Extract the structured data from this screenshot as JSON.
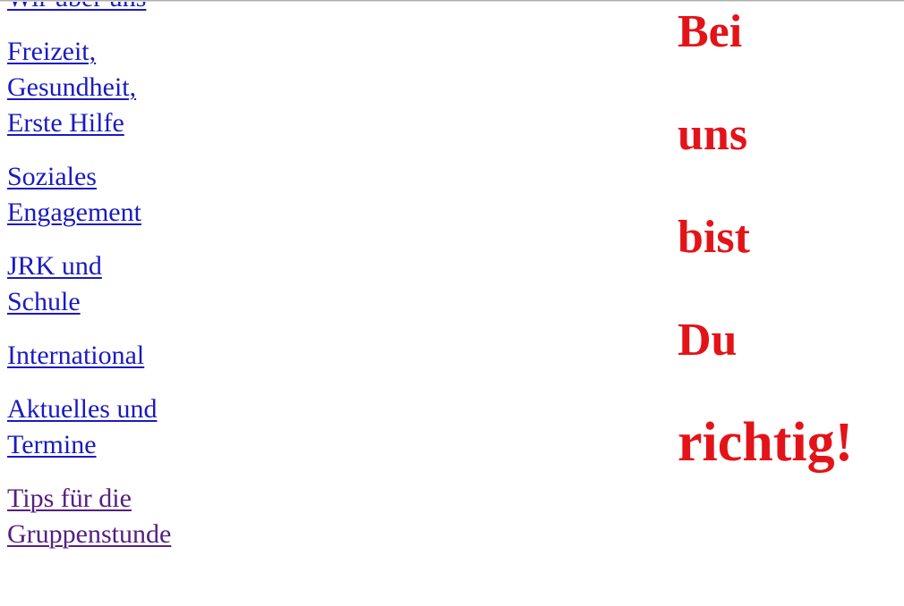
{
  "page": {
    "background_color": "#ffffff",
    "top_rule_color": "#9a9a9a"
  },
  "nav": {
    "link_color": "#1a1ac2",
    "visited_color": "#56207f",
    "items": [
      {
        "label": "Wir über uns",
        "visited": false
      },
      {
        "label": "Freizeit,\nGesundheit,\nErste Hilfe",
        "visited": false
      },
      {
        "label": "Soziales\nEngagement",
        "visited": false
      },
      {
        "label": "JRK und\nSchule",
        "visited": false
      },
      {
        "label": "International",
        "visited": false
      },
      {
        "label": "Aktuelles und\nTermine",
        "visited": false
      },
      {
        "label": "Tips für die\nGruppenstunde",
        "visited": true
      }
    ]
  },
  "slogan": {
    "color": "#e31419",
    "words": [
      {
        "text": "Bei",
        "emphasis": false
      },
      {
        "text": "uns",
        "emphasis": false
      },
      {
        "text": "bist",
        "emphasis": false
      },
      {
        "text": "Du",
        "emphasis": false
      },
      {
        "text": "richtig!",
        "emphasis": true
      }
    ]
  }
}
